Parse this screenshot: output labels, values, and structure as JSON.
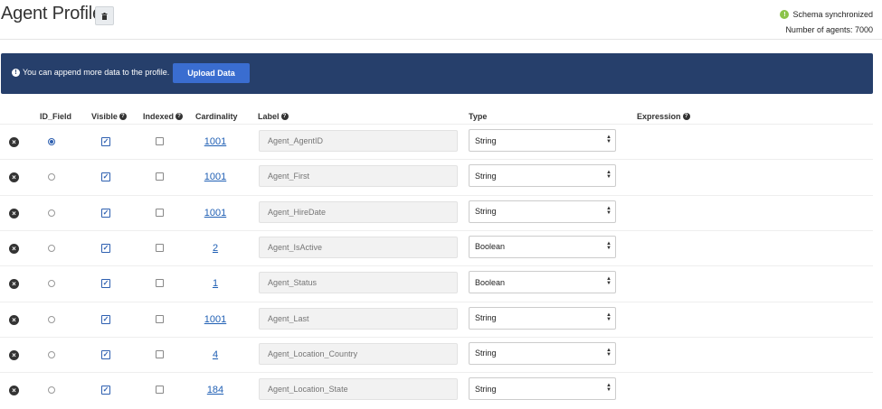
{
  "header": {
    "title": "Agent Profile",
    "status_text": "Schema synchronized",
    "agent_count_text": "Number of agents: 7000"
  },
  "banner": {
    "message": "You can append more data to the profile.",
    "upload_label": "Upload Data"
  },
  "columns": {
    "id_field": "ID_Field",
    "visible": "Visible",
    "indexed": "Indexed",
    "cardinality": "Cardinality",
    "label": "Label",
    "type": "Type",
    "expression": "Expression"
  },
  "rows": [
    {
      "id_selected": true,
      "visible": true,
      "indexed": false,
      "cardinality": "1001",
      "label": "Agent_AgentID",
      "type": "String"
    },
    {
      "id_selected": false,
      "visible": true,
      "indexed": false,
      "cardinality": "1001",
      "label": "Agent_First",
      "type": "String"
    },
    {
      "id_selected": false,
      "visible": true,
      "indexed": false,
      "cardinality": "1001",
      "label": "Agent_HireDate",
      "type": "String"
    },
    {
      "id_selected": false,
      "visible": true,
      "indexed": false,
      "cardinality": "2",
      "label": "Agent_IsActive",
      "type": "Boolean"
    },
    {
      "id_selected": false,
      "visible": true,
      "indexed": false,
      "cardinality": "1",
      "label": "Agent_Status",
      "type": "Boolean"
    },
    {
      "id_selected": false,
      "visible": true,
      "indexed": false,
      "cardinality": "1001",
      "label": "Agent_Last",
      "type": "String"
    },
    {
      "id_selected": false,
      "visible": true,
      "indexed": false,
      "cardinality": "4",
      "label": "Agent_Location_Country",
      "type": "String"
    },
    {
      "id_selected": false,
      "visible": true,
      "indexed": false,
      "cardinality": "184",
      "label": "Agent_Location_State",
      "type": "String"
    }
  ]
}
